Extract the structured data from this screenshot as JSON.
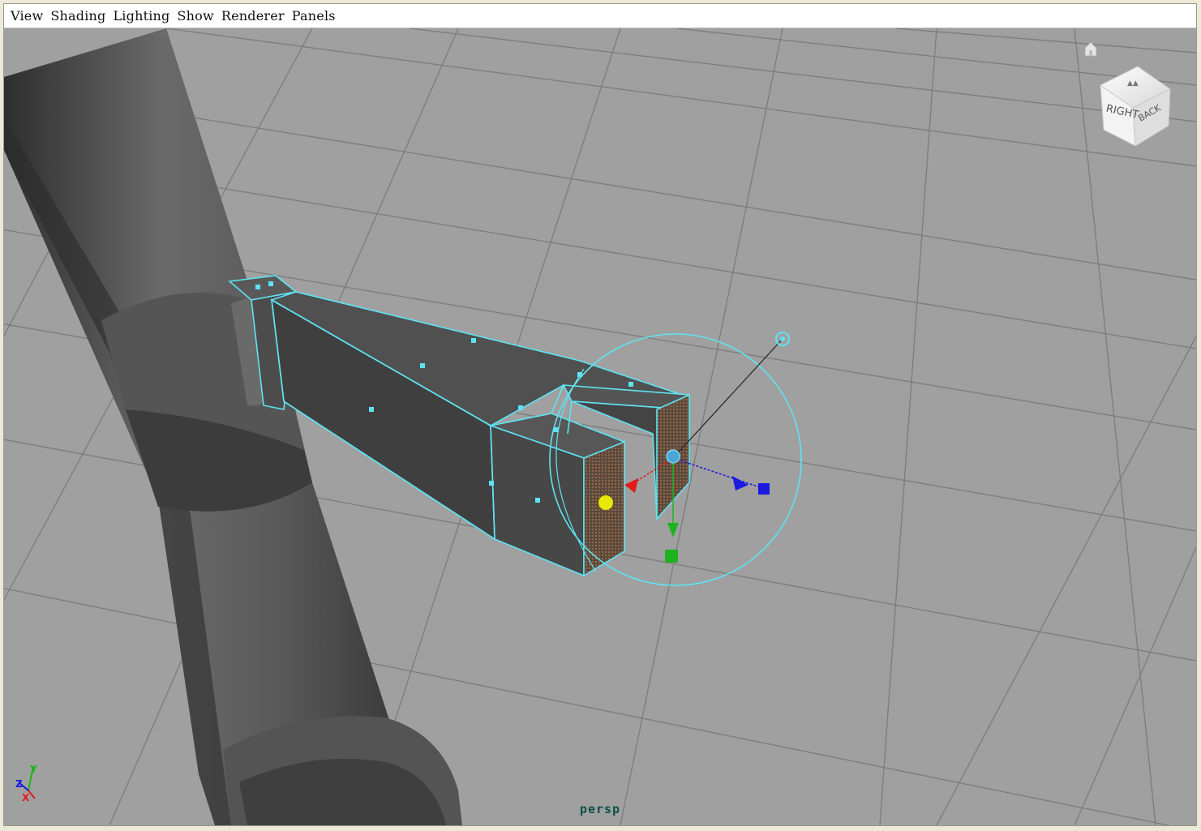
{
  "menubar": {
    "items": [
      {
        "label": "View"
      },
      {
        "label": "Shading"
      },
      {
        "label": "Lighting"
      },
      {
        "label": "Show"
      },
      {
        "label": "Renderer"
      },
      {
        "label": "Panels"
      }
    ]
  },
  "viewport": {
    "camera_label": "persp",
    "background_color": "#a0a0a0",
    "grid_color": "#7e7e7e",
    "selection_color": "#5fe3f2",
    "mesh_color": "#4a4a4a"
  },
  "viewcube": {
    "face_right": "RIGHT",
    "face_back": "BACK",
    "home_icon": "home-icon"
  },
  "axis_indicator": {
    "x_label": "X",
    "y_label": "Y",
    "z_label": "Z"
  },
  "manipulator": {
    "x_axis_color": "#e11a1a",
    "y_axis_color": "#1fb21f",
    "z_axis_color": "#1a1ae1",
    "center_color": "#e8e800"
  }
}
